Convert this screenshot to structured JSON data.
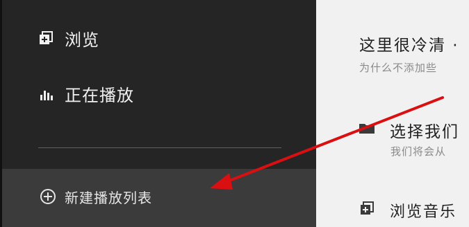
{
  "sidebar": {
    "items": [
      {
        "label": "浏览",
        "icon": "browse-icon"
      },
      {
        "label": "正在播放",
        "icon": "equalizer-icon"
      }
    ],
    "new_playlist": {
      "label": "新建播放列表",
      "icon": "add-circle-icon"
    }
  },
  "main": {
    "title": "这里很冷清 ·",
    "subtitle": "为什么不添加些",
    "option1": {
      "label": "选择我们",
      "sub": "我们将会从",
      "icon": "folder-icon"
    },
    "option2": {
      "label": "浏览音乐",
      "icon": "browse-icon"
    }
  },
  "annotation": {
    "arrow_color": "#d90f12"
  },
  "colors": {
    "sidebar_bg": "#252525",
    "selected_bg": "#3b3b3b",
    "main_bg": "#f1f1f1"
  }
}
